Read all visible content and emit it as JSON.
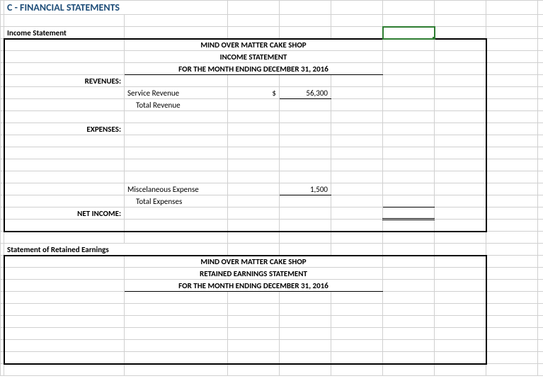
{
  "section_title": "C - FINANCIAL STATEMENTS",
  "income_statement": {
    "heading": "Income Statement",
    "title1": "MIND OVER MATTER CAKE SHOP",
    "title2": "INCOME STATEMENT",
    "title3": "FOR THE MONTH ENDING DECEMBER 31, 2016",
    "revenues_label": "REVENUES:",
    "service_revenue_label": "Service Revenue",
    "service_revenue_currency": "$",
    "service_revenue_amount": "56,300",
    "total_revenue_label": "Total Revenue",
    "expenses_label": "EXPENSES:",
    "misc_expense_label": "Miscelaneous Expense",
    "misc_expense_amount": "1,500",
    "total_expenses_label": "Total Expenses",
    "net_income_label": "NET INCOME:"
  },
  "retained_earnings": {
    "heading": "Statement of Retained Earnings",
    "title1": "MIND OVER MATTER CAKE SHOP",
    "title2": "RETAINED EARNINGS STATEMENT",
    "title3": "FOR THE MONTH ENDING DECEMBER 31, 2016"
  }
}
